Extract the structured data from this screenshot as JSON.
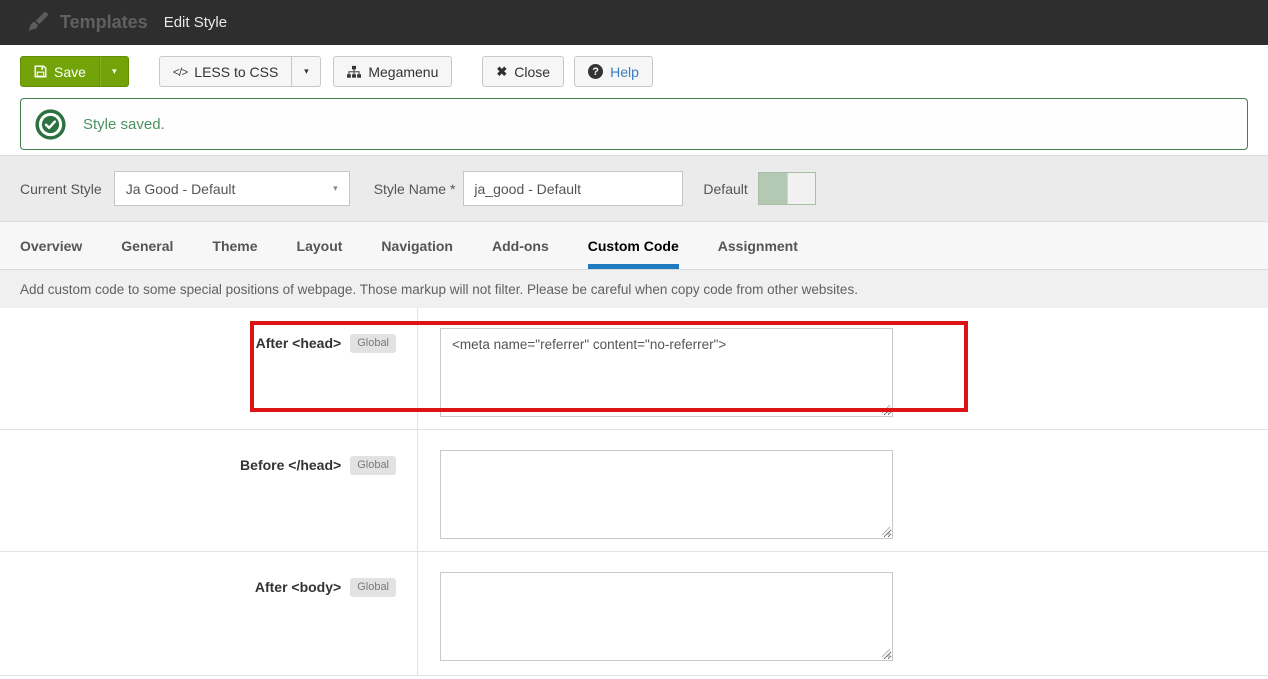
{
  "titlebar": {
    "app_label": "Templates",
    "page_title": "Edit Style"
  },
  "toolbar": {
    "save_label": "Save",
    "less_to_css_label": "LESS to CSS",
    "megamenu_label": "Megamenu",
    "close_label": "Close",
    "help_label": "Help"
  },
  "icons": {
    "caret_down": "▾",
    "code": "</>",
    "close_x": "✖",
    "help_q": "?"
  },
  "alert": {
    "message": "Style saved."
  },
  "style_bar": {
    "current_style_label": "Current Style",
    "current_style_value": "Ja Good - Default",
    "style_name_label": "Style Name *",
    "style_name_value": "ja_good - Default",
    "default_label": "Default",
    "default_on": true
  },
  "tabs": [
    {
      "label": "Overview",
      "active": false
    },
    {
      "label": "General",
      "active": false
    },
    {
      "label": "Theme",
      "active": false
    },
    {
      "label": "Layout",
      "active": false
    },
    {
      "label": "Navigation",
      "active": false
    },
    {
      "label": "Add-ons",
      "active": false
    },
    {
      "label": "Custom Code",
      "active": true
    },
    {
      "label": "Assignment",
      "active": false
    }
  ],
  "description": "Add custom code to some special positions of webpage. Those markup will not filter. Please be careful when copy code from other websites.",
  "fields": [
    {
      "label": "After <head>",
      "badge": "Global",
      "value": "<meta name=\"referrer\" content=\"no-referrer\">",
      "highlighted": true
    },
    {
      "label": "Before </head>",
      "badge": "Global",
      "value": "",
      "highlighted": false
    },
    {
      "label": "After <body>",
      "badge": "Global",
      "value": "",
      "highlighted": false
    }
  ],
  "colors": {
    "topbar_bg": "#2e2e2e",
    "save_green": "#72a308",
    "alert_border": "#40804f",
    "alert_text": "#4c9160",
    "alert_icon_green": "#2d7140",
    "tab_active_underline": "#1e7bbf",
    "toggle_on_green": "#b3c9b3",
    "highlight_red": "#dc1414"
  }
}
